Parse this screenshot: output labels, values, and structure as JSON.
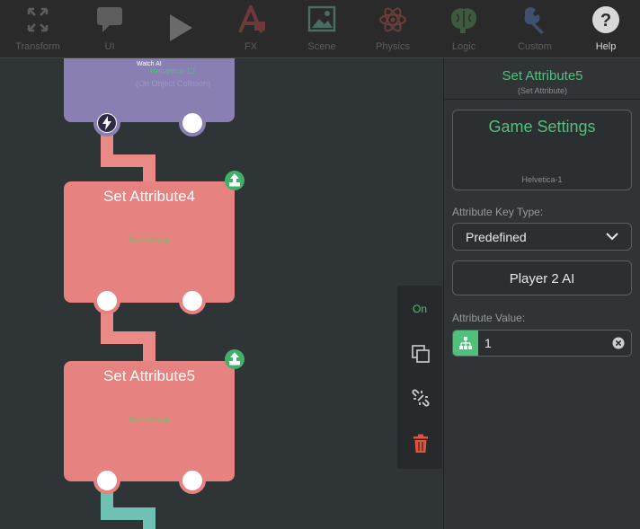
{
  "toolbar": {
    "items": [
      {
        "label": "Transform",
        "icon": "expand-arrows-icon"
      },
      {
        "label": "UI",
        "icon": "speech-bubble-icon"
      },
      {
        "label": "",
        "icon": "play-icon"
      },
      {
        "label": "FX",
        "icon": "fx-icon"
      },
      {
        "label": "Scene",
        "icon": "image-icon"
      },
      {
        "label": "Physics",
        "icon": "atom-icon"
      },
      {
        "label": "Logic",
        "icon": "brain-icon"
      },
      {
        "label": "Custom",
        "icon": "wrench-icon"
      },
      {
        "label": "Help",
        "icon": "question-icon"
      }
    ]
  },
  "canvas": {
    "top_node": {
      "title": "Watch AI",
      "font_label": "Helvetica-13",
      "subtitle": "(On Object Collision)"
    },
    "nodes": [
      {
        "title": "Set Attribute4",
        "subtitle": "Game Settings"
      },
      {
        "title": "Set Attribute5",
        "subtitle": "Game Settings"
      }
    ]
  },
  "side_tools": {
    "toggle_label": "On",
    "colors": {
      "on": "#4fc17a",
      "delete": "#e0533c"
    }
  },
  "inspector": {
    "title": "Set Attribute5",
    "subtitle": "(Set Attribute)",
    "name_box": {
      "text": "Game Settings",
      "font": "Helvetica-1"
    },
    "key_type_label": "Attribute Key Type:",
    "key_type_value": "Predefined",
    "key_button": "Player 2 AI",
    "value_label": "Attribute Value:",
    "value": "1"
  },
  "colors": {
    "accent_green": "#4fc17a",
    "node_red": "#e6827f",
    "node_purple": "#8a7fb3",
    "connector_teal": "#6fc1b4"
  }
}
